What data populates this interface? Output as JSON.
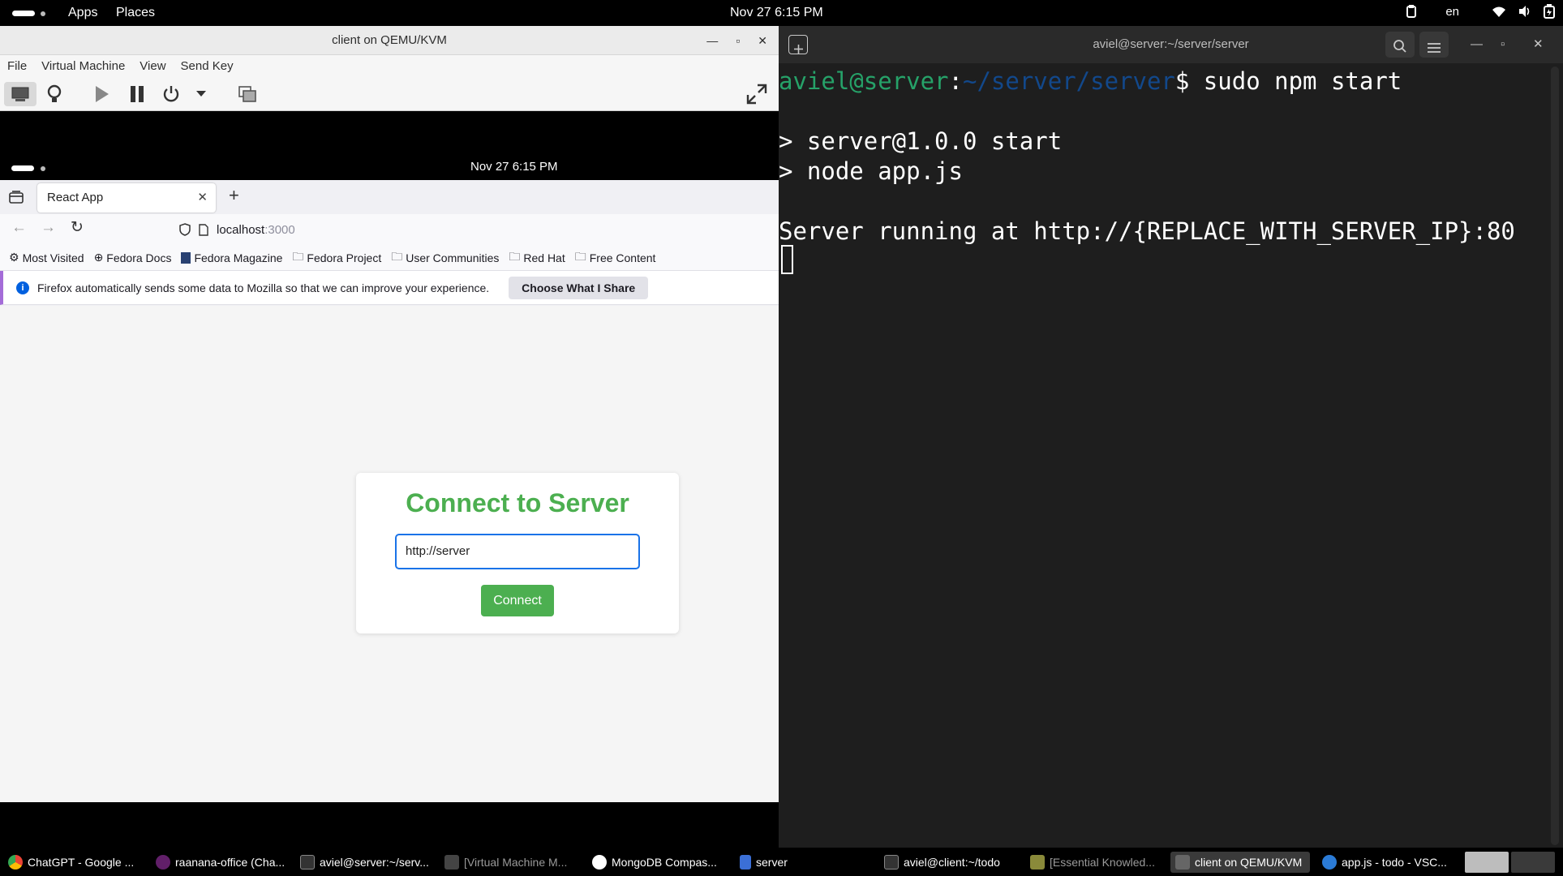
{
  "topbar": {
    "apps": "Apps",
    "places": "Places",
    "clock": "Nov 27  6:15 PM",
    "lang": "en"
  },
  "vm": {
    "title": "client on QEMU/KVM",
    "menu": [
      "File",
      "Virtual Machine",
      "View",
      "Send Key"
    ],
    "guest_clock": "Nov 27  6:15 PM"
  },
  "firefox": {
    "tab_title": "React App",
    "url_host": "localhost",
    "url_port": ":3000",
    "bookmarks": [
      "Most Visited",
      "Fedora Docs",
      "Fedora Magazine",
      "Fedora Project",
      "User Communities",
      "Red Hat",
      "Free Content"
    ],
    "notice_text": "Firefox automatically sends some data to Mozilla so that we can improve your experience.",
    "notice_button": "Choose What I Share"
  },
  "page": {
    "heading": "Connect to Server",
    "input_value": "http://server",
    "button": "Connect"
  },
  "terminal": {
    "title": "aviel@server:~/server/server",
    "prompt_user": "aviel@server",
    "prompt_path": "~/server/server",
    "command": "$ sudo npm start",
    "out1": "> server@1.0.0 start",
    "out2": "> node app.js",
    "out3": "Server running at http://{REPLACE_WITH_SERVER_IP}:80"
  },
  "taskbar": [
    "ChatGPT - Google ...",
    "raanana-office (Cha...",
    "aviel@server:~/serv...",
    "[Virtual Machine M...",
    "MongoDB Compas...",
    "server",
    "aviel@client:~/todo",
    "[Essential Knowled...",
    "client on QEMU/KVM",
    "app.js - todo - VSC..."
  ],
  "colors": {
    "accent_green": "#4caf50",
    "prompt_green": "#26a269",
    "prompt_blue": "#12488b",
    "focus_blue": "#1a73e8"
  }
}
